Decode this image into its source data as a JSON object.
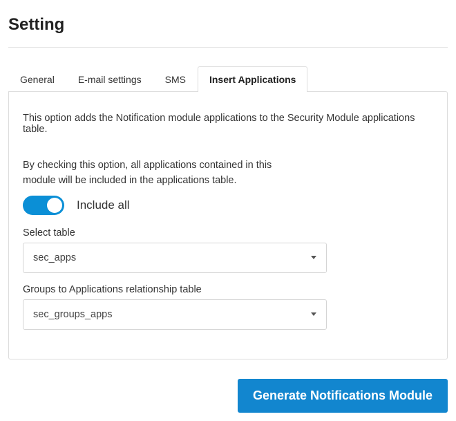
{
  "page": {
    "title": "Setting"
  },
  "tabs": {
    "items": [
      {
        "label": "General"
      },
      {
        "label": "E-mail settings"
      },
      {
        "label": "SMS"
      },
      {
        "label": "Insert Applications"
      }
    ],
    "activeIndex": 3
  },
  "panel": {
    "intro": "This option adds the Notification module applications to the Security Module applications table.",
    "subtext": "By checking this option, all applications contained in this module will be included in the applications table.",
    "toggle": {
      "on": true,
      "label": "Include all"
    },
    "select_table": {
      "label": "Select table",
      "value": "sec_apps"
    },
    "groups_table": {
      "label": "Groups to Applications relationship table",
      "value": "sec_groups_apps"
    }
  },
  "footer": {
    "button": "Generate Notifications Module"
  },
  "colors": {
    "accent": "#1286cf",
    "toggle": "#0b8fd6"
  }
}
